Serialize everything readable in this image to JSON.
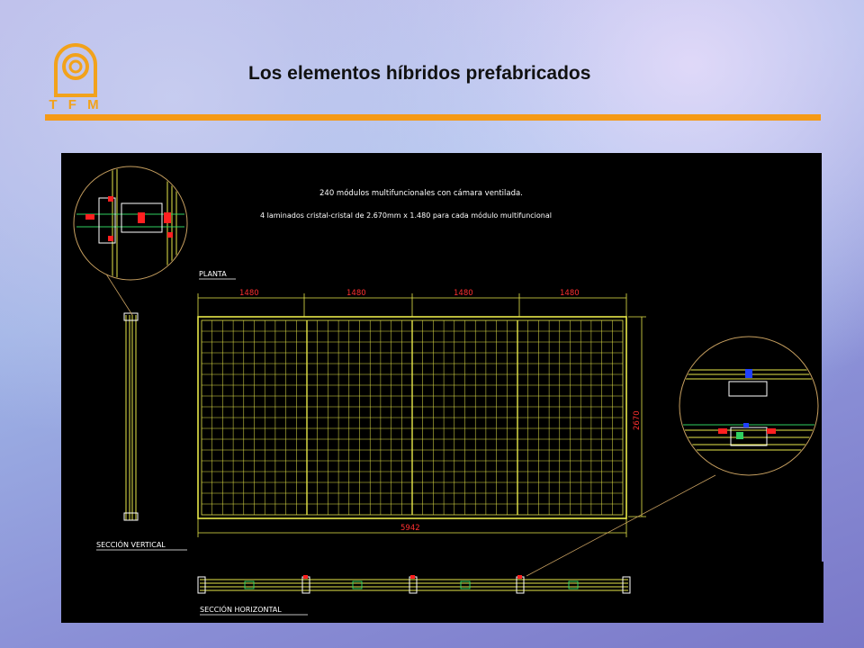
{
  "header": {
    "title": "Los elementos híbridos prefabricados",
    "logo_text": "T F M"
  },
  "drawing": {
    "note_line1": "240 módulos multifuncionales con cámara ventilada.",
    "note_line2": "4 laminados cristal-cristal de 2.670mm x 1.480 para cada módulo multifuncional",
    "plan_label": "PLANTA",
    "dim_top": [
      "1480",
      "1480",
      "1480",
      "1480"
    ],
    "dim_height": "2670",
    "dim_total": "5942",
    "section_vertical_label": "SECCIÓN VERTICAL",
    "section_horizontal_label": "SECCIÓN HORIZONTAL"
  },
  "colors": {
    "accent": "#f59a16",
    "cad_yellow": "#e8e84a",
    "cad_red": "#ff2020",
    "cad_bg": "#000000"
  }
}
